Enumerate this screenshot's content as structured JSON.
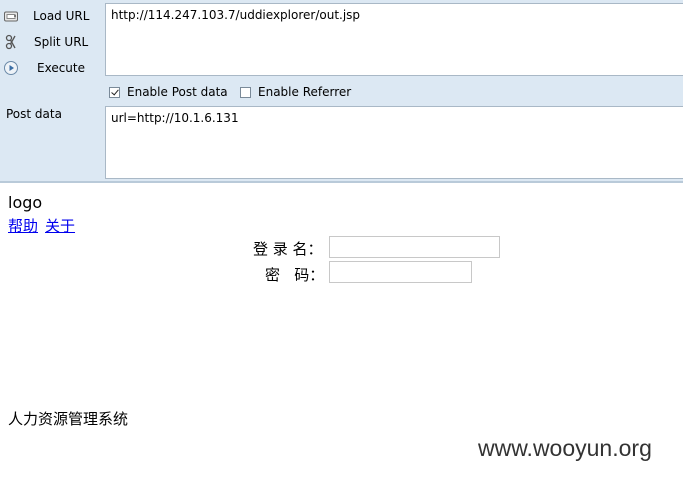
{
  "hackbar": {
    "buttons": {
      "load_url": "Load URL",
      "split_url": "Split URL",
      "execute": "Execute"
    },
    "url_value": "http://114.247.103.7/uddiexplorer/out.jsp",
    "options": {
      "enable_post_data": {
        "label": "Enable Post data",
        "checked": true
      },
      "enable_referrer": {
        "label": "Enable Referrer",
        "checked": false
      }
    },
    "post_data_label": "Post data",
    "post_data_value": "url=http://10.1.6.131"
  },
  "page": {
    "logo": "logo",
    "links": {
      "help": "帮助",
      "about": "关于"
    },
    "login": {
      "username_label": "登 录 名：",
      "password_label": "密   码：",
      "username_value": "",
      "password_value": ""
    },
    "system_name": "人力资源管理系统"
  },
  "watermark": "www.wooyun.org",
  "colors": {
    "hackbar_bg": "#dce8f3",
    "link": "#0000ee"
  }
}
